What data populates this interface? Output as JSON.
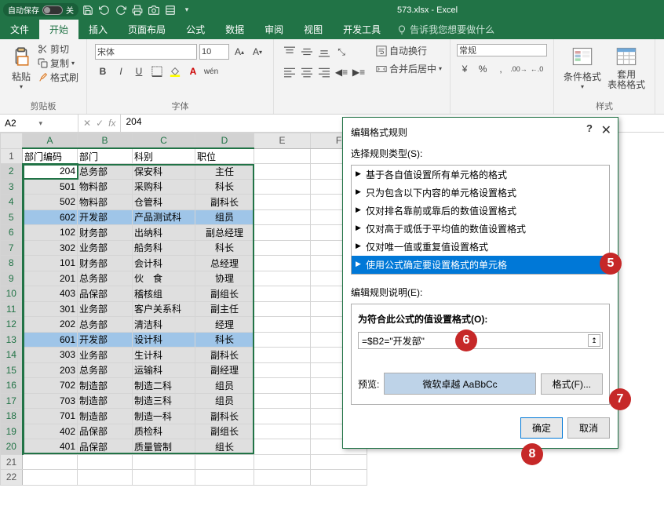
{
  "titlebar": {
    "autosave": "自动保存",
    "autosave_state": "关",
    "filename": "573.xlsx - Excel"
  },
  "tabs": [
    "文件",
    "开始",
    "插入",
    "页面布局",
    "公式",
    "数据",
    "审阅",
    "视图",
    "开发工具"
  ],
  "tell_me": "告诉我您想要做什么",
  "ribbon": {
    "clipboard": {
      "label": "剪贴板",
      "paste": "粘贴",
      "cut": "剪切",
      "copy": "复制",
      "painter": "格式刷"
    },
    "font": {
      "label": "字体",
      "name": "宋体",
      "size": "10",
      "bold": "B",
      "italic": "I",
      "underline": "U",
      "wen": "wén"
    },
    "alignment": {
      "label": "",
      "wrap": "自动换行",
      "merge": "合并后居中"
    },
    "number": {
      "label": "",
      "format": "常规"
    },
    "styles": {
      "label": "样式",
      "cond": "条件格式",
      "table": "套用\n表格格式"
    }
  },
  "name_box": "A2",
  "formula": "204",
  "columns": [
    "A",
    "B",
    "C",
    "D",
    "E",
    "F"
  ],
  "data": {
    "headers": [
      "部门编码",
      "部门",
      "科别",
      "职位"
    ],
    "rows": [
      [
        "204",
        "总务部",
        "保安科",
        "主任"
      ],
      [
        "501",
        "物料部",
        "采购科",
        "科长"
      ],
      [
        "502",
        "物料部",
        "仓管科",
        "副科长"
      ],
      [
        "602",
        "开发部",
        "产品测试科",
        "组员"
      ],
      [
        "102",
        "财务部",
        "出纳科",
        "副总经理"
      ],
      [
        "302",
        "业务部",
        "船务科",
        "科长"
      ],
      [
        "101",
        "财务部",
        "会计科",
        "总经理"
      ],
      [
        "201",
        "总务部",
        "伙　食",
        "协理"
      ],
      [
        "403",
        "品保部",
        "稽核组",
        "副组长"
      ],
      [
        "301",
        "业务部",
        "客户关系科",
        "副主任"
      ],
      [
        "202",
        "总务部",
        "清洁科",
        "经理"
      ],
      [
        "601",
        "开发部",
        "设计科",
        "科长"
      ],
      [
        "303",
        "业务部",
        "生计科",
        "副科长"
      ],
      [
        "203",
        "总务部",
        "运输科",
        "副经理"
      ],
      [
        "702",
        "制造部",
        "制造二科",
        "组员"
      ],
      [
        "703",
        "制造部",
        "制造三科",
        "组员"
      ],
      [
        "701",
        "制造部",
        "制造一科",
        "副科长"
      ],
      [
        "402",
        "品保部",
        "质检科",
        "副组长"
      ],
      [
        "401",
        "品保部",
        "质量管制",
        "组长"
      ]
    ]
  },
  "highlight_rows": [
    3,
    11
  ],
  "dialog": {
    "title": "编辑格式规则",
    "select_rule_label": "选择规则类型(S):",
    "rules": [
      "基于各自值设置所有单元格的格式",
      "只为包含以下内容的单元格设置格式",
      "仅对排名靠前或靠后的数值设置格式",
      "仅对高于或低于平均值的数值设置格式",
      "仅对唯一值或重复值设置格式",
      "使用公式确定要设置格式的单元格"
    ],
    "selected_rule": 5,
    "edit_label": "编辑规则说明(E):",
    "formula_label": "为符合此公式的值设置格式(O):",
    "formula_value": "=$B2=\"开发部\"",
    "preview_label": "预览:",
    "preview_text": "微软卓越 AaBbCc",
    "format_btn": "格式(F)...",
    "ok": "确定",
    "cancel": "取消"
  },
  "badges": {
    "5": 5,
    "6": 6,
    "7": 7,
    "8": 8
  }
}
